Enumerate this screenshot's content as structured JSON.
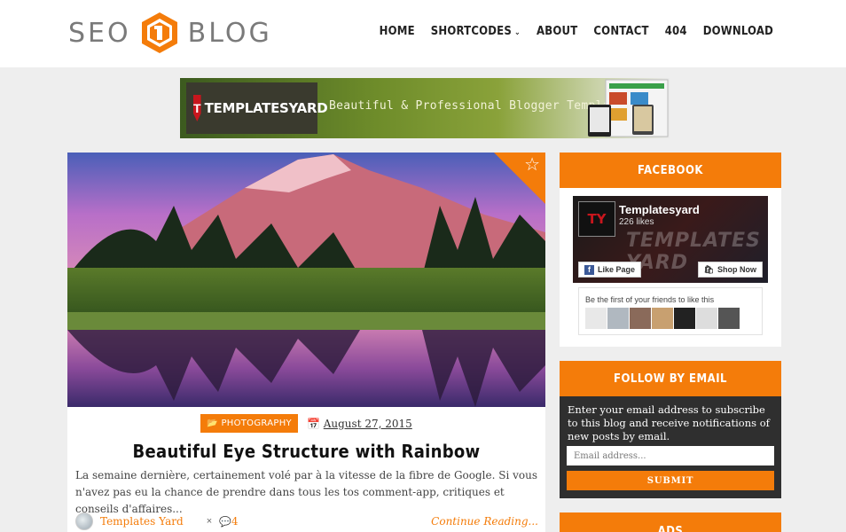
{
  "header": {
    "logo_left": "SEO",
    "logo_right": "BLOG",
    "nav": [
      "HOME",
      "SHORTCODES",
      "ABOUT",
      "CONTACT",
      "404",
      "DOWNLOAD"
    ]
  },
  "banner": {
    "brand": "TEMPLATESYARD",
    "tagline": "Beautiful & Professional Blogger Templates"
  },
  "post": {
    "category": "PHOTOGRAPHY",
    "date": "August 27, 2015",
    "title": "Beautiful Eye Structure with Rainbow",
    "excerpt": "La semaine dernière, certainement volé par à la vitesse de la fibre de Google. Si vous n'avez pas eu la chance de prendre dans tous les tos comment-app, critiques et conseils d'affaires...",
    "author": "Templates Yard",
    "comment_count": "4",
    "read_more": "Continue Reading..."
  },
  "sidebar": {
    "facebook": {
      "title": "FACEBOOK",
      "page_name": "Templatesyard",
      "likes": "226 likes",
      "like_button": "Like Page",
      "shop_button": "Shop Now",
      "friends_text": "Be the first of your friends to like this"
    },
    "email": {
      "title": "FOLLOW BY EMAIL",
      "description": "Enter your email address to subscribe to this blog and receive notifications of new posts by email.",
      "placeholder": "Email address...",
      "submit": "SUBMIT"
    },
    "ads": {
      "title": "ADS"
    }
  },
  "colors": {
    "accent": "#f47c0a",
    "dark_panel": "#2f2f2f",
    "background": "#eeeeee"
  }
}
